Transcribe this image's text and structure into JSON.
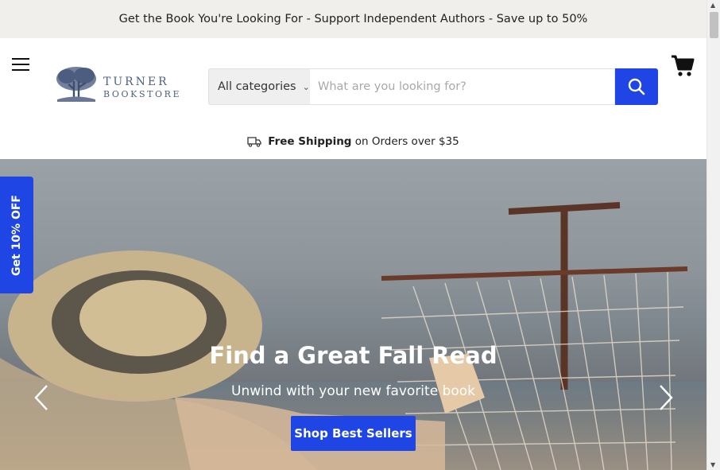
{
  "announcement": "Get the Book You're Looking For - Support Independent Authors - Save up to 50%",
  "header": {
    "logo_line1": "TURNER",
    "logo_line2": "BOOKSTORE",
    "search": {
      "category": "All categories",
      "placeholder": "What are you looking for?"
    }
  },
  "shipping": {
    "bold": "Free Shipping",
    "rest": "on Orders over $35"
  },
  "hero": {
    "title": "Find a Great Fall Read",
    "subtitle": "Unwind with your new favorite book",
    "button": "Shop Best Sellers"
  },
  "discount_tab": "Get 10% OFF",
  "colors": {
    "accent": "#1f46e5",
    "announcement_bg": "#f0efec"
  },
  "icons": [
    "menu-icon",
    "search-icon",
    "cart-icon",
    "truck-icon",
    "chevron-left-icon",
    "chevron-right-icon"
  ]
}
